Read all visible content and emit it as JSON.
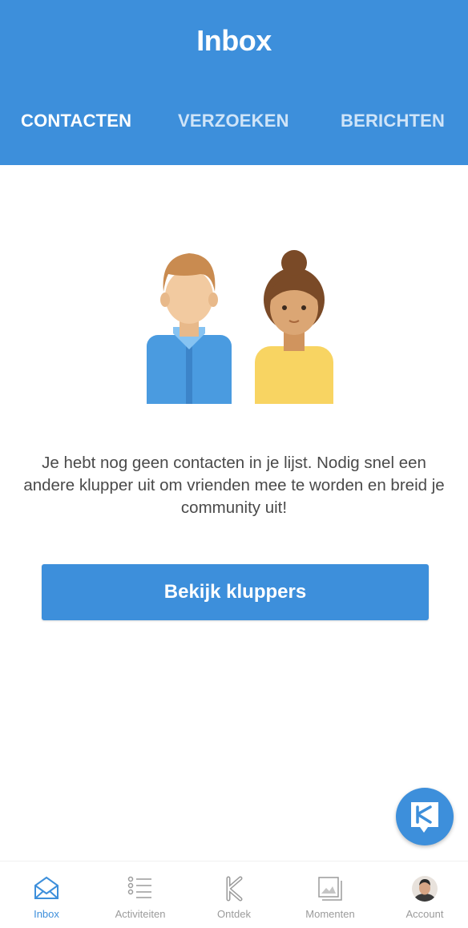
{
  "header": {
    "title": "Inbox",
    "tabs": [
      {
        "label": "CONTACTEN",
        "active": true
      },
      {
        "label": "VERZOEKEN",
        "active": false
      },
      {
        "label": "BERICHTEN",
        "active": false
      }
    ]
  },
  "main": {
    "empty_message": "Je hebt nog geen contacten in je lijst. Nodig snel een andere klupper uit om vrienden mee te worden en breid je community uit!",
    "cta_label": "Bekijk kluppers"
  },
  "bottom_nav": {
    "items": [
      {
        "label": "Inbox",
        "icon": "envelope-icon",
        "active": true
      },
      {
        "label": "Activiteiten",
        "icon": "list-icon",
        "active": false
      },
      {
        "label": "Ontdek",
        "icon": "k-logo-icon",
        "active": false
      },
      {
        "label": "Momenten",
        "icon": "photo-stack-icon",
        "active": false
      },
      {
        "label": "Account",
        "icon": "avatar",
        "active": false
      }
    ]
  },
  "colors": {
    "primary": "#3d8fdb",
    "tab_inactive": "#cfe4f8",
    "text": "#4a4a4a",
    "nav_inactive": "#9b9b9b"
  }
}
